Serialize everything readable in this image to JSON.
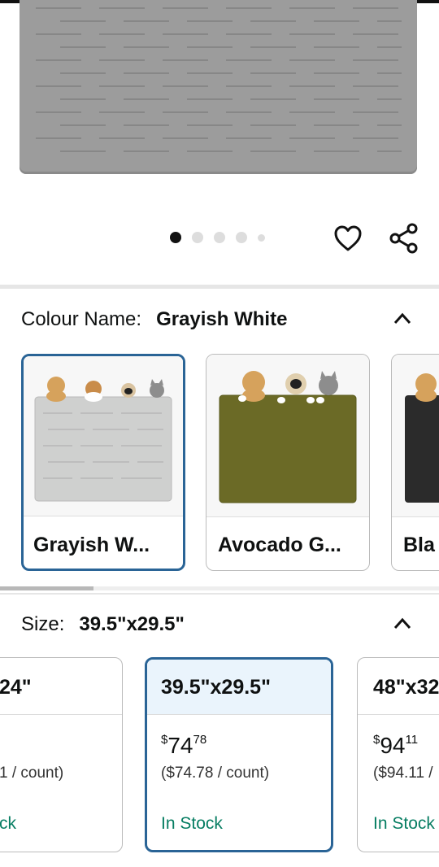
{
  "gallery": {
    "dot_count": 5,
    "active_index": 0
  },
  "colour": {
    "label": "Colour Name:",
    "selected": "Grayish White",
    "options": [
      {
        "name": "Grayish W...",
        "color": "#cfd0cf"
      },
      {
        "name": "Avocado G...",
        "color": "#6b6a26"
      },
      {
        "name": "Bla",
        "color": "#2b2b2b"
      }
    ]
  },
  "size": {
    "label": "Size:",
    "selected": "39.5\"x29.5\"",
    "options": [
      {
        "size": "24\"",
        "price_whole": "",
        "price_frac": "",
        "unit": "1 / count)",
        "stock": "ck",
        "currency": ""
      },
      {
        "size": "39.5\"x29.5\"",
        "currency": "$",
        "price_whole": "74",
        "price_frac": "78",
        "unit": "($74.78 / count)",
        "stock": "In Stock"
      },
      {
        "size": "48\"x32",
        "currency": "$",
        "price_whole": "94",
        "price_frac": "11",
        "unit": "($94.11 /",
        "stock": "In Stock"
      }
    ]
  },
  "colors": {
    "selected_border": "#2a6496",
    "stock_green": "#067d62",
    "mat_gray": "#9c9c9c"
  }
}
